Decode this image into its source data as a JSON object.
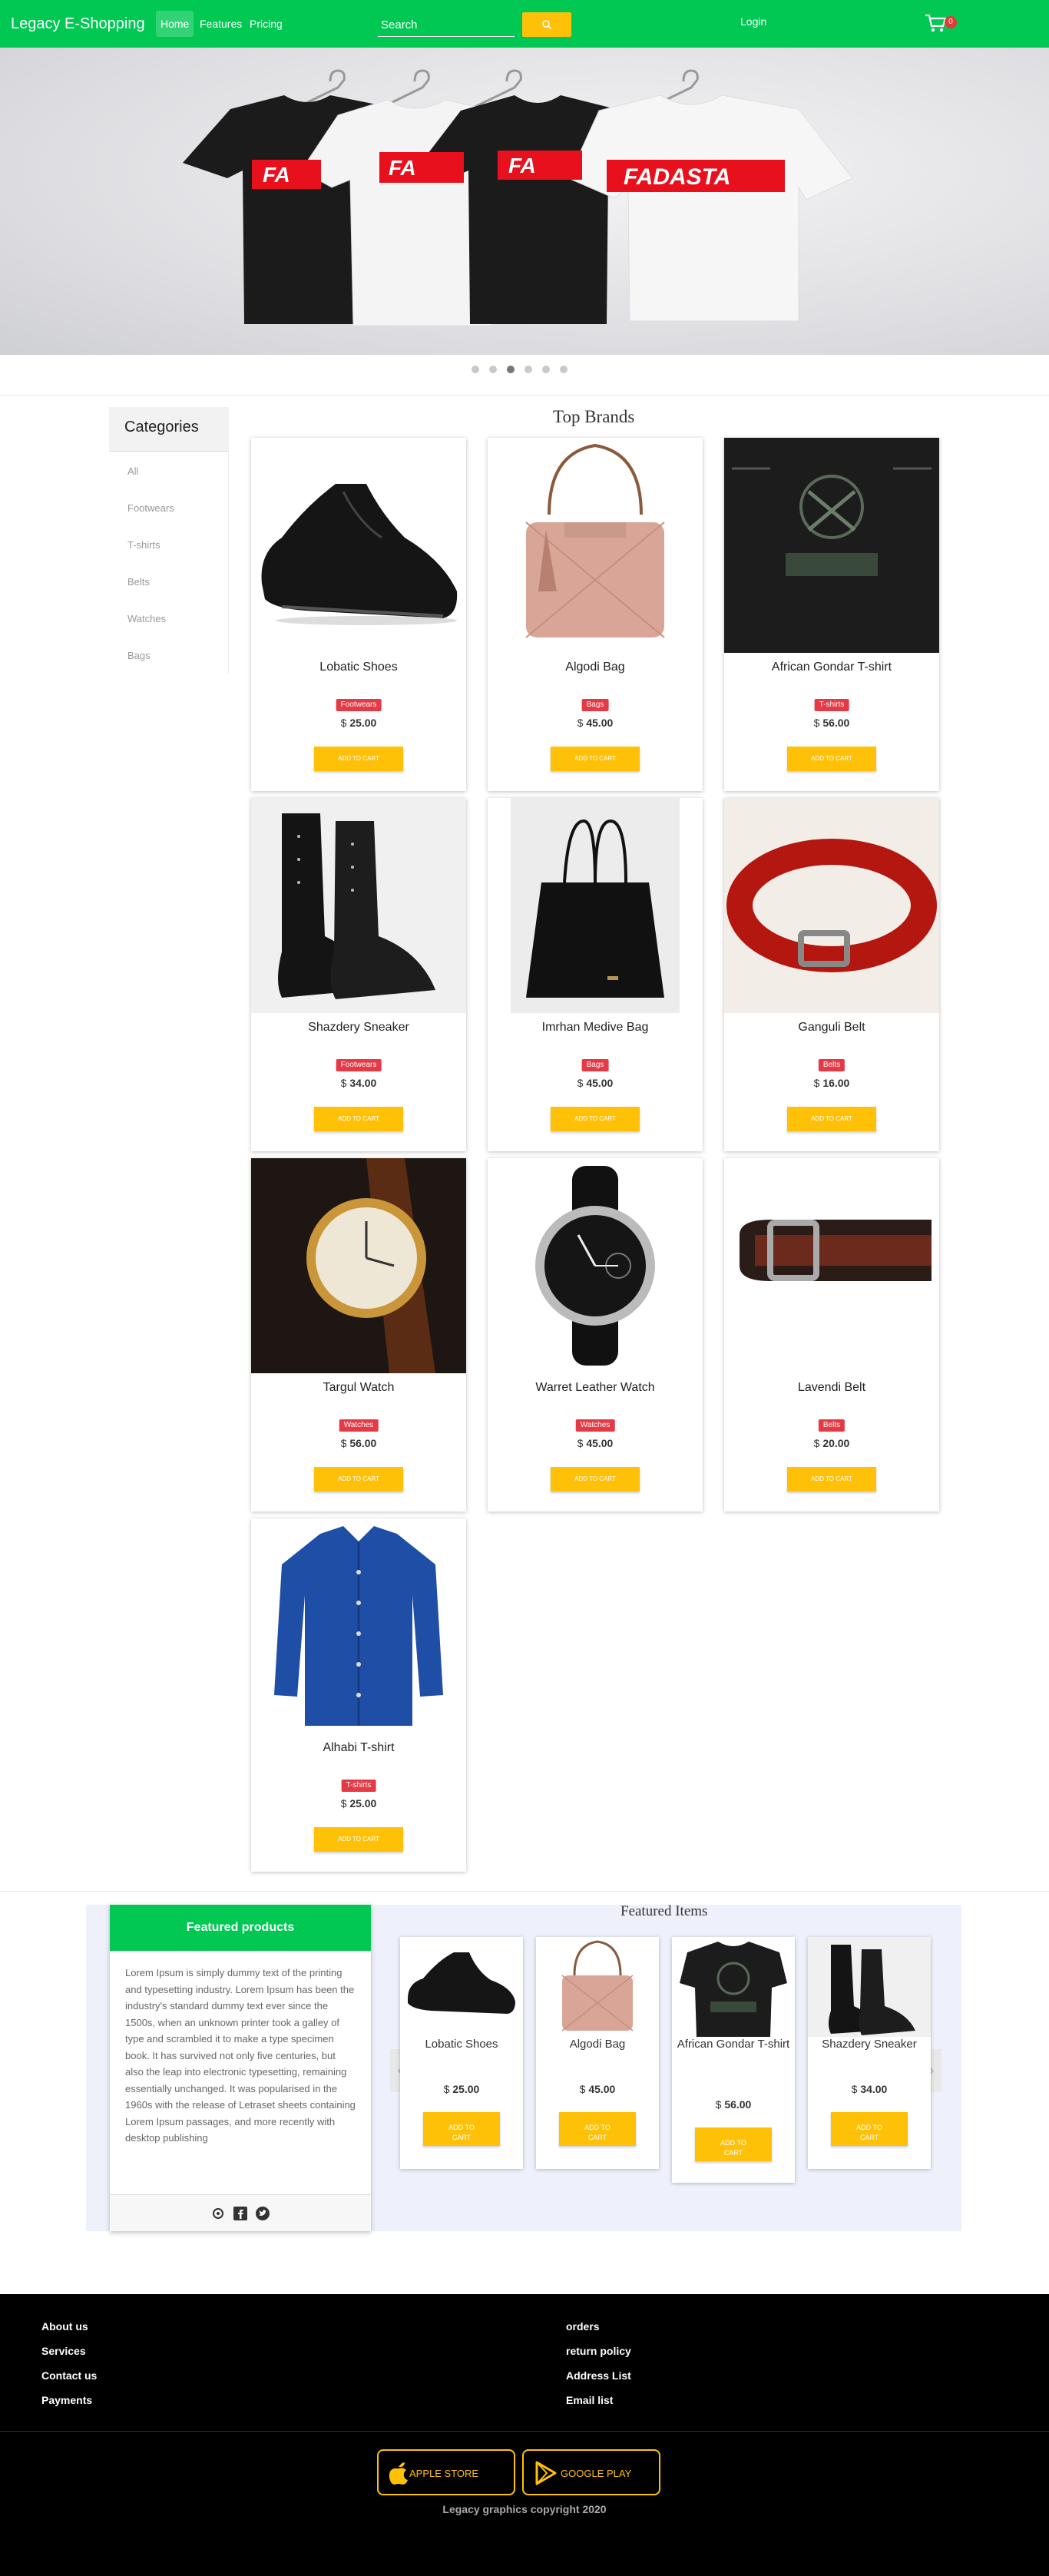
{
  "nav": {
    "brand": "Legacy E-Shopping",
    "links": [
      "Home",
      "Features",
      "Pricing"
    ],
    "search_placeholder": "Search",
    "login": "Login",
    "cart_count": "0"
  },
  "hero": {
    "tshirt_text": "FADASTA",
    "tshirt_text_partial": "FA"
  },
  "categories": {
    "title": "Categories",
    "items": [
      "All",
      "Footwears",
      "T-shirts",
      "Belts",
      "Watches",
      "Bags"
    ]
  },
  "top_brands": {
    "title": "Top Brands",
    "button_label": "ADD TO CART",
    "currency": "$",
    "products": [
      {
        "name": "Lobatic Shoes",
        "category": "Footwears",
        "price": "25.00"
      },
      {
        "name": "Algodi Bag",
        "category": "Bags",
        "price": "45.00"
      },
      {
        "name": "African Gondar T-shirt",
        "category": "T-shirts",
        "price": "56.00"
      },
      {
        "name": "Shazdery Sneaker",
        "category": "Footwears",
        "price": "34.00"
      },
      {
        "name": "Imrhan Medive Bag",
        "category": "Bags",
        "price": "45.00"
      },
      {
        "name": "Ganguli Belt",
        "category": "Belts",
        "price": "16.00"
      },
      {
        "name": "Targul Watch",
        "category": "Watches",
        "price": "56.00"
      },
      {
        "name": "Warret Leather Watch",
        "category": "Watches",
        "price": "45.00"
      },
      {
        "name": "Lavendi Belt",
        "category": "Belts",
        "price": "20.00"
      },
      {
        "name": "Alhabi T-shirt",
        "category": "T-shirts",
        "price": "25.00"
      }
    ]
  },
  "featured": {
    "panel_title": "Featured products",
    "panel_text": "Lorem Ipsum is simply dummy text of the printing and typesetting industry. Lorem Ipsum has been the industry's standard dummy text ever since the 1500s, when an unknown printer took a galley of type and scrambled it to make a type specimen book. It has survived not only five centuries, but also the leap into electronic typesetting, remaining essentially unchanged. It was popularised in the 1960s with the release of Letraset sheets containing Lorem Ipsum passages, and more recently with desktop publishing",
    "title": "Featured Items",
    "button_line1": "ADD TO",
    "button_line2": "CART",
    "items": [
      {
        "name": "Lobatic Shoes",
        "price": "25.00"
      },
      {
        "name": "Algodi Bag",
        "price": "45.00"
      },
      {
        "name": "African Gondar T-shirt",
        "price": "56.00"
      },
      {
        "name": "Shazdery Sneaker",
        "price": "34.00"
      }
    ],
    "prev_arrow": "‹",
    "next_arrow": "›"
  },
  "footer": {
    "left_links": [
      "About us",
      "Services",
      "Contact us",
      "Payments"
    ],
    "right_links": [
      "orders",
      "return policy",
      "Address List",
      "Email list"
    ],
    "apple_label": "APPLE STORE",
    "google_label": "GOOGLE PLAY",
    "copyright": "Legacy graphics copyright 2020"
  },
  "colors": {
    "brand_green": "#00c853",
    "accent_yellow": "#ffc107",
    "badge_red": "#e53946"
  }
}
